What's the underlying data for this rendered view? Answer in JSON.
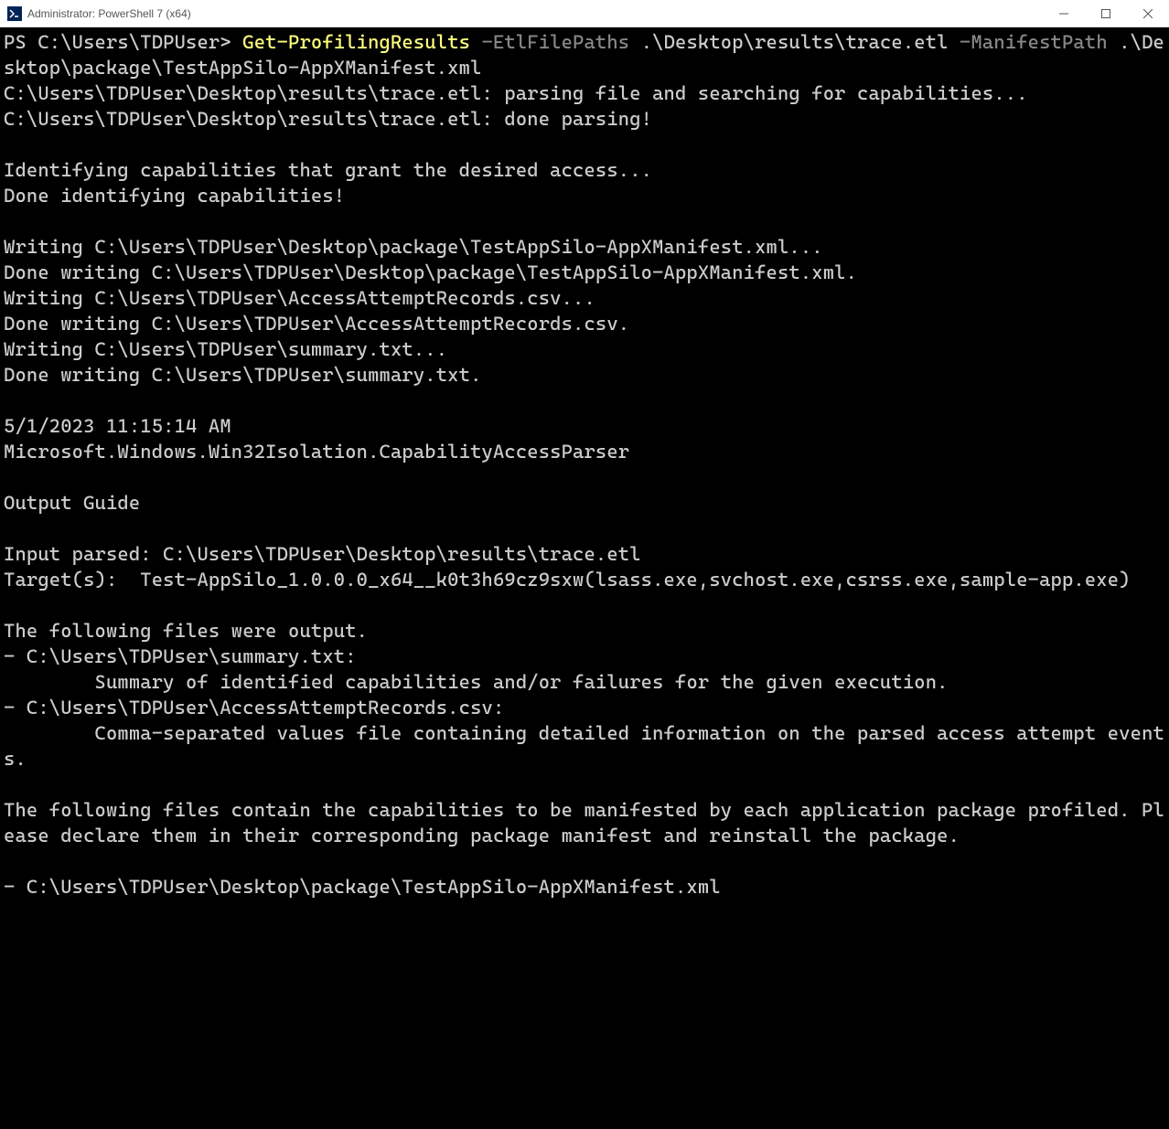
{
  "window": {
    "title": "Administrator: PowerShell 7 (x64)",
    "icon_label": "powershell-icon"
  },
  "terminal": {
    "prompt": "PS C:\\Users\\TDPUser> ",
    "cmdlet": "Get-ProfilingResults",
    "param1_name": " -EtlFilePaths",
    "param1_value": " .\\Desktop\\results\\trace.etl ",
    "param2_name": "-ManifestPath",
    "param2_value": " .\\Desktop\\package\\TestAppSilo-AppXManifest.xml",
    "output": "C:\\Users\\TDPUser\\Desktop\\results\\trace.etl: parsing file and searching for capabilities...\nC:\\Users\\TDPUser\\Desktop\\results\\trace.etl: done parsing!\n\nIdentifying capabilities that grant the desired access...\nDone identifying capabilities!\n\nWriting C:\\Users\\TDPUser\\Desktop\\package\\TestAppSilo-AppXManifest.xml...\nDone writing C:\\Users\\TDPUser\\Desktop\\package\\TestAppSilo-AppXManifest.xml.\nWriting C:\\Users\\TDPUser\\AccessAttemptRecords.csv...\nDone writing C:\\Users\\TDPUser\\AccessAttemptRecords.csv.\nWriting C:\\Users\\TDPUser\\summary.txt...\nDone writing C:\\Users\\TDPUser\\summary.txt.\n\n5/1/2023 11:15:14 AM\nMicrosoft.Windows.Win32Isolation.CapabilityAccessParser\n\nOutput Guide\n\nInput parsed: C:\\Users\\TDPUser\\Desktop\\results\\trace.etl\nTarget(s):  Test-AppSilo_1.0.0.0_x64__k0t3h69cz9sxw(lsass.exe,svchost.exe,csrss.exe,sample-app.exe)\n\nThe following files were output.\n- C:\\Users\\TDPUser\\summary.txt:\n        Summary of identified capabilities and/or failures for the given execution.\n- C:\\Users\\TDPUser\\AccessAttemptRecords.csv:\n        Comma-separated values file containing detailed information on the parsed access attempt events.\n\nThe following files contain the capabilities to be manifested by each application package profiled. Please declare them in their corresponding package manifest and reinstall the package.\n\n- C:\\Users\\TDPUser\\Desktop\\package\\TestAppSilo-AppXManifest.xml"
  }
}
